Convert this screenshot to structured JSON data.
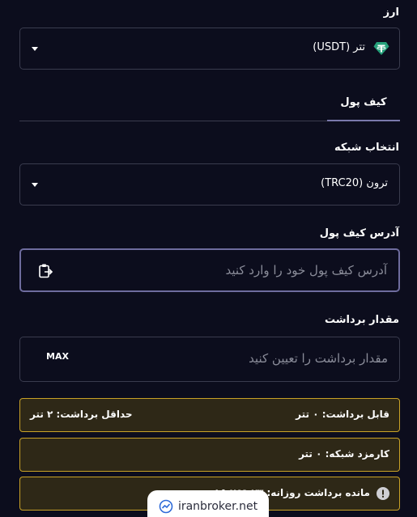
{
  "currency": {
    "label": "ارز",
    "selected": "تتر (USDT)",
    "icon": "tether-icon"
  },
  "tabs": [
    {
      "label": "کیف پول",
      "active": true
    }
  ],
  "network": {
    "label": "انتخاب شبکه",
    "selected": "ترون (TRC20)"
  },
  "address": {
    "label": "آدرس کیف پول",
    "placeholder": "آدرس کیف پول خود را وارد کنید",
    "icon": "clipboard-paste-icon"
  },
  "amount": {
    "label": "مقدار برداشت",
    "placeholder": "مقدار برداشت را تعیین کنید",
    "max_label": "MAX"
  },
  "info": {
    "withdrawable": "قابل برداشت: ۰ تتر",
    "min_withdraw": "حداقل برداشت: ۲ تتر",
    "network_fee": "کارمزد شبکه: ۰ تتر",
    "daily_remaining": "مانده برداشت روزانه: ۱۵,۷۶۹.۲۳ تتر"
  },
  "watermark": {
    "text": "iranbroker.net"
  },
  "colors": {
    "background": "#0c0d1d",
    "border": "#3a3c4e",
    "accent": "#6e6c9e",
    "warning_border": "#c9a227",
    "warning_bg": "#2e2817",
    "tether": "#26a17b"
  }
}
